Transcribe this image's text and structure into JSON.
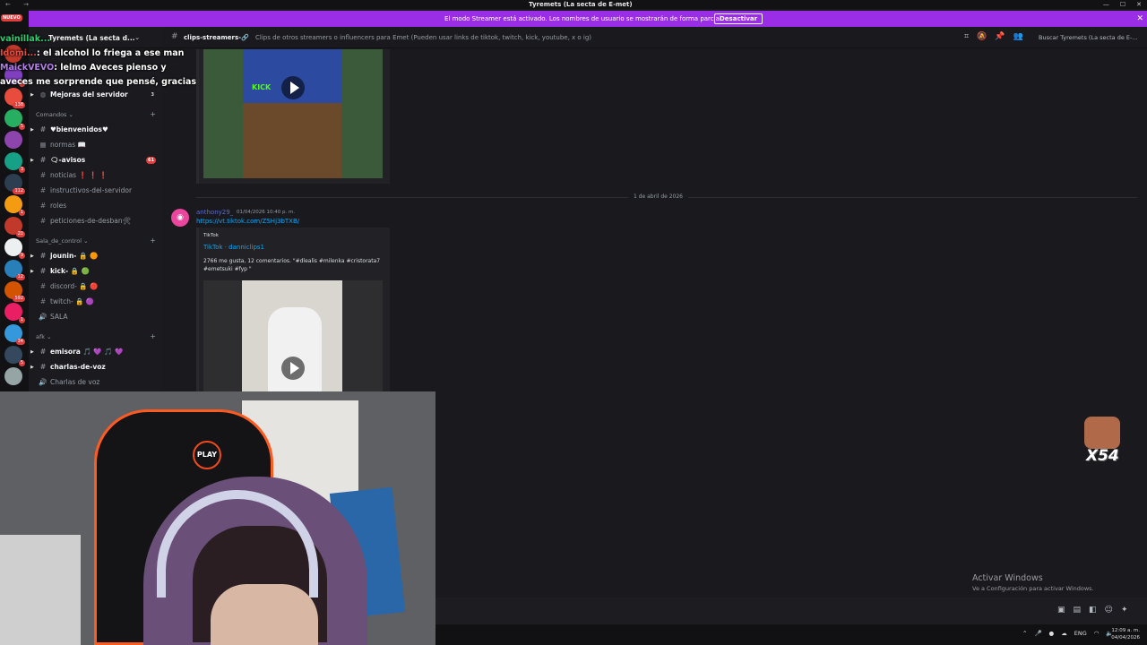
{
  "window": {
    "title": "Tyremets (La secta de E-met)",
    "controls": [
      "—",
      "☐",
      "✕"
    ]
  },
  "streamer_bar": {
    "message": "El modo Streamer está activado. Los nombres de usuario se mostrarán de forma parcial.",
    "button": "Desactivar",
    "close": "✕"
  },
  "servers": {
    "new_badge": "NUEVO",
    "items": [
      {
        "color": "#c0392b",
        "badge": ""
      },
      {
        "color": "#7f3fbf",
        "badge": "7"
      },
      {
        "color": "#e74c3c",
        "badge": "138"
      },
      {
        "color": "#27ae60",
        "badge": "5"
      },
      {
        "color": "#8e44ad",
        "badge": ""
      },
      {
        "color": "#16a085",
        "badge": "3"
      },
      {
        "color": "#2c3e50",
        "badge": "112"
      },
      {
        "color": "#f39c12",
        "badge": "1"
      },
      {
        "color": "#c0392b",
        "badge": "20"
      },
      {
        "color": "#ecf0f1",
        "badge": "9"
      },
      {
        "color": "#2980b9",
        "badge": "12"
      },
      {
        "color": "#d35400",
        "badge": "592"
      },
      {
        "color": "#e91e63",
        "badge": "1"
      },
      {
        "color": "#3498db",
        "badge": "34"
      },
      {
        "color": "#34495e",
        "badge": "5"
      },
      {
        "color": "#95a5a6",
        "badge": ""
      }
    ]
  },
  "server": {
    "name": "Tyremets (La secta d...",
    "chevron": "⌄"
  },
  "channels": [
    {
      "name": "Mejoras del servidor",
      "bold": true,
      "count": "3",
      "plain_count": true,
      "icon": "◍",
      "arrow": true
    },
    {
      "category": "Comandos ⌄"
    },
    {
      "name": "♥bienvenidos♥",
      "bold": true,
      "icon": "#",
      "arrow": true
    },
    {
      "name": "normas 📖",
      "bold": false,
      "icon": "▦"
    },
    {
      "name": "🗨-avisos",
      "bold": true,
      "count": "61",
      "icon": "#",
      "arrow": true
    },
    {
      "name": "noticias ❗ ❗ ❗",
      "bold": false,
      "icon": "#"
    },
    {
      "name": "instructivos-del-servidor",
      "bold": false,
      "icon": "#"
    },
    {
      "name": "roles",
      "bold": false,
      "icon": "#"
    },
    {
      "name": "peticiones-de-desban🛠",
      "bold": false,
      "icon": "#"
    },
    {
      "category": "Sala_de_control ⌄"
    },
    {
      "name": "jounin- 🔒 🟠",
      "bold": true,
      "icon": "#",
      "arrow": true
    },
    {
      "name": "kick- 🔒 🟢",
      "bold": true,
      "icon": "#",
      "arrow": true
    },
    {
      "name": "discord- 🔒 🔴",
      "bold": false,
      "icon": "#"
    },
    {
      "name": "twitch- 🔒 🟣",
      "bold": false,
      "icon": "#"
    },
    {
      "name": "SALA",
      "bold": false,
      "icon": "🔊"
    },
    {
      "category": "afk ⌄"
    },
    {
      "name": "emisora 🎵 💜 🎵 💜",
      "bold": true,
      "icon": "#",
      "arrow": true
    },
    {
      "name": "charlas-de-voz",
      "bold": true,
      "icon": "#",
      "arrow": true
    },
    {
      "name": "Charlas de voz",
      "bold": false,
      "icon": "🔊"
    }
  ],
  "chat_overlay": [
    {
      "user": "vainillak...",
      "text": ""
    },
    {
      "user": "Idomi...",
      "text": ": el alcohol lo friega a ese man"
    },
    {
      "user": "MaickVEVO",
      "text": ": lelmo Aveces pienso y aveces me sorprende que pensé, gracias"
    }
  ],
  "topbar": {
    "channel": "clips-streamers-🔗",
    "topic": "Clips de otros streamers o influencers para Emet (Pueden usar links de tiktok, twitch, kick, youtube, x o ig)",
    "icons": [
      "threads-icon",
      "mute-icon",
      "pin-icon",
      "members-icon"
    ],
    "search_placeholder": "Buscar Tyremets (La secta de E-..."
  },
  "messages": {
    "video1_label": "KICK",
    "date_divider": "1 de abril de 2026",
    "author": "anthony29_",
    "timestamp": "01/04/2026 10:40 p. m.",
    "link": "https://vt.tiktok.com/ZSHj3bTXB/",
    "embed": {
      "provider": "TikTok",
      "title": "TikTok · danniclips1",
      "description": "2766 me gusta, 12 comentarios. \"#dlealis #milenka #cristorata7 #emetsuki #fyp \""
    }
  },
  "webcam": {
    "chair_logo": "PLAY"
  },
  "overlay": {
    "multiplier": "X54",
    "activate_title": "Activar Windows",
    "activate_sub": "Ve a Configuración para activar Windows."
  },
  "taskbar": {
    "lang": "ENG",
    "time": "12:09 a. m.",
    "date": "04/04/2026"
  }
}
